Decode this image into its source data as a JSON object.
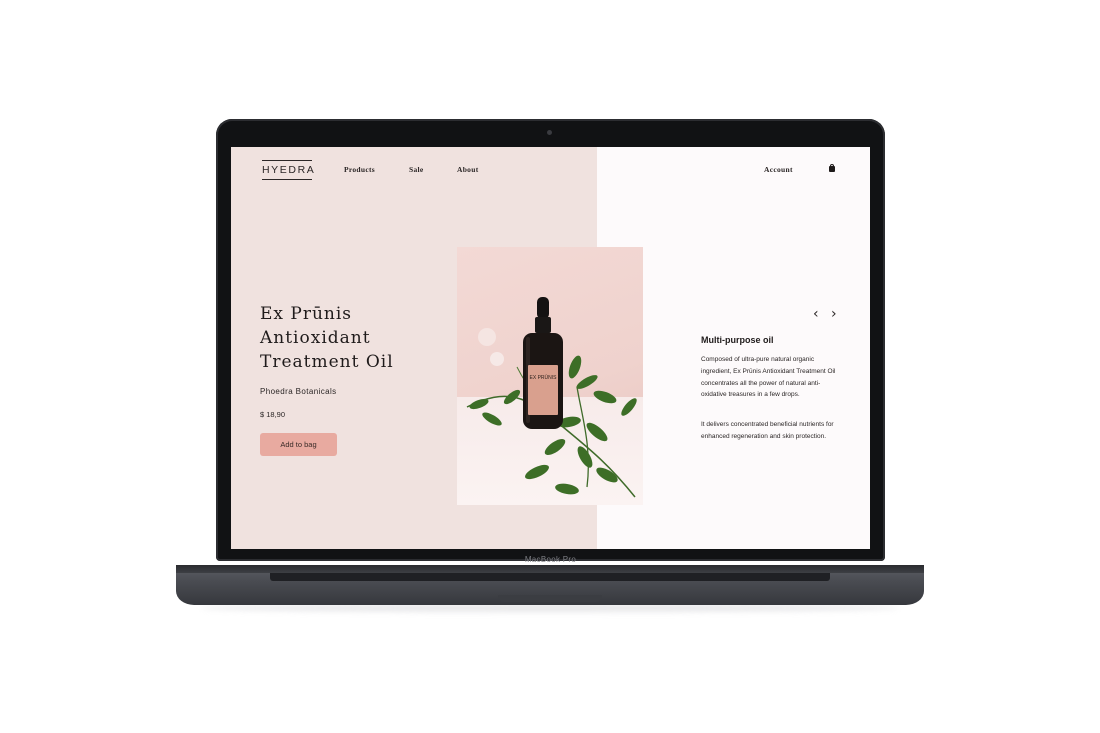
{
  "device": {
    "model_label": "MacBook Pro"
  },
  "header": {
    "logo": "HYEDRA",
    "nav": [
      "Products",
      "Sale",
      "About"
    ],
    "account_label": "Account",
    "bag_icon": "shopping-bag-icon"
  },
  "product": {
    "title_line1": "Ex Prūnis",
    "title_line2": "Antioxidant",
    "title_line3": "Treatment Oil",
    "brand": "Phoedra Botanicals",
    "price": "$ 18,90",
    "add_button_label": "Add to bag",
    "bottle_label": "EX PRŪNIS"
  },
  "description": {
    "heading": "Multi-purpose oil",
    "paragraph1": "Composed of ultra-pure natural organic ingredient, Ex Prūnis Antioxidant Treatment Oil  concentrates all the power of natural anti-oxidative treasures in a few drops.",
    "paragraph2": "It delivers concentrated beneficial nutrients for enhanced regeneration and skin protection.",
    "prev_icon": "chevron-left-icon",
    "next_icon": "chevron-right-icon"
  },
  "colors": {
    "left_panel": "#f0e2df",
    "right_panel": "#fdfafb",
    "button": "#e8aaa0",
    "text": "#1f1b1b"
  }
}
